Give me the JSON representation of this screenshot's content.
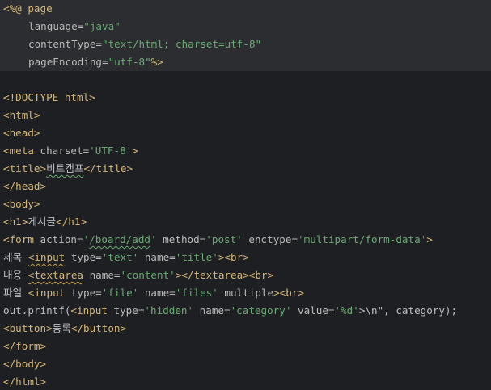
{
  "editor": {
    "directive": {
      "open": "<%@",
      "keyword": "page",
      "language_attr": "language=",
      "language_val": "\"java\"",
      "content_type_attr": "contentType=",
      "content_type_val": "\"text/html; charset=utf-8\"",
      "page_encoding_attr": "pageEncoding=",
      "page_encoding_val": "\"utf-8\"",
      "close": "%>"
    },
    "doctype": "<!DOCTYPE html>",
    "html_open": "<html>",
    "head_open": "<head>",
    "meta_open": "<meta",
    "meta_attr": " charset=",
    "meta_val": "'UTF-8'",
    "meta_close": ">",
    "title_open": "<title>",
    "title_text": "비트캠프",
    "title_close": "</title>",
    "head_close": "</head>",
    "body_open": "<body>",
    "h1_open": "<h1>",
    "h1_text": "게시글",
    "h1_close": "</h1>",
    "form_open": "<form",
    "form_action_attr": " action=",
    "form_action_val": "'/board/add'",
    "form_method_attr": " method=",
    "form_method_val": "'post'",
    "form_enctype_attr": " enctype=",
    "form_enctype_val": "'multipart/form-data'",
    "form_gt": ">",
    "title_label": "제목 ",
    "input_tag": "<input",
    "type_attr": " type=",
    "type_text_val": "'text'",
    "name_attr": " name=",
    "name_title_val": "'title'",
    "gt_br": "><br>",
    "content_label": "내용 ",
    "textarea_tag": "<textarea",
    "name_content_val": "'content'",
    "textarea_close": "></textarea><br>",
    "files_label": "파일 ",
    "type_file_val": "'file'",
    "name_files_val": "'files'",
    "multiple_attr": " multiple",
    "printf_prefix": "out.printf(",
    "type_hidden_val": "'hidden'",
    "name_category_val": "'category'",
    "value_attr": " value=",
    "value_val": "'%d'",
    "printf_suffix": ">\\n\", category);",
    "printf_input_tag": "<input",
    "button_open": "<button>",
    "button_text": "등록",
    "button_close": "</button>",
    "form_close": "</form>",
    "body_close": "</body>",
    "html_close": "</html>"
  }
}
